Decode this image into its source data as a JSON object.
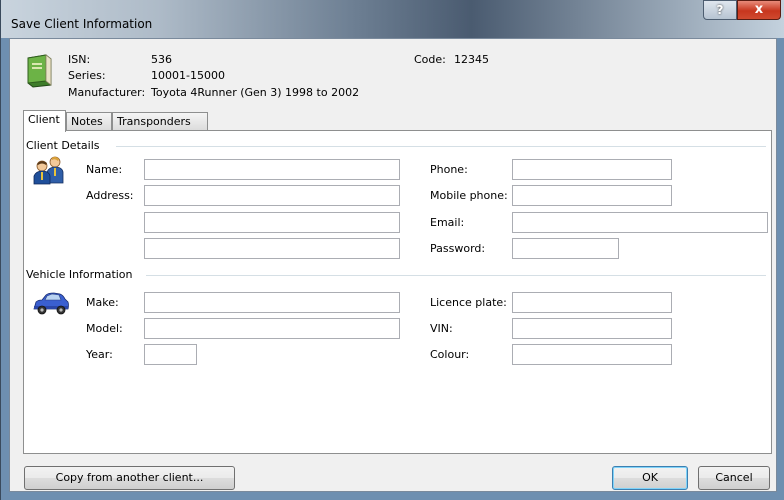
{
  "window": {
    "title": "Save Client Information",
    "help_label": "?",
    "close_label": "x",
    "accent_close": "#c7361e"
  },
  "header": {
    "isn_label": "ISN:",
    "isn_value": "536",
    "series_label": "Series:",
    "series_value": "10001-15000",
    "manufacturer_label": "Manufacturer:",
    "manufacturer_value": "Toyota 4Runner (Gen 3) 1998 to 2002",
    "code_label": "Code:",
    "code_value": "12345",
    "icon": "green-book-icon"
  },
  "tabs": [
    {
      "label": "Client",
      "active": true
    },
    {
      "label": "Notes",
      "active": false
    },
    {
      "label": "Transponders",
      "active": false
    }
  ],
  "client_details": {
    "title": "Client Details",
    "icon": "people-icon",
    "name_label": "Name:",
    "address_label": "Address:",
    "phone_label": "Phone:",
    "mobile_label": "Mobile phone:",
    "email_label": "Email:",
    "password_label": "Password:",
    "name_value": "",
    "address1_value": "",
    "address2_value": "",
    "address3_value": "",
    "phone_value": "",
    "mobile_value": "",
    "email_value": "",
    "password_value": ""
  },
  "vehicle_info": {
    "title": "Vehicle Information",
    "icon": "car-icon",
    "make_label": "Make:",
    "model_label": "Model:",
    "year_label": "Year:",
    "plate_label": "Licence plate:",
    "vin_label": "VIN:",
    "colour_label": "Colour:",
    "make_value": "",
    "model_value": "",
    "year_value": "",
    "plate_value": "",
    "vin_value": "",
    "colour_value": ""
  },
  "buttons": {
    "copy_label": "Copy from another client...",
    "ok_label": "OK",
    "cancel_label": "Cancel"
  }
}
